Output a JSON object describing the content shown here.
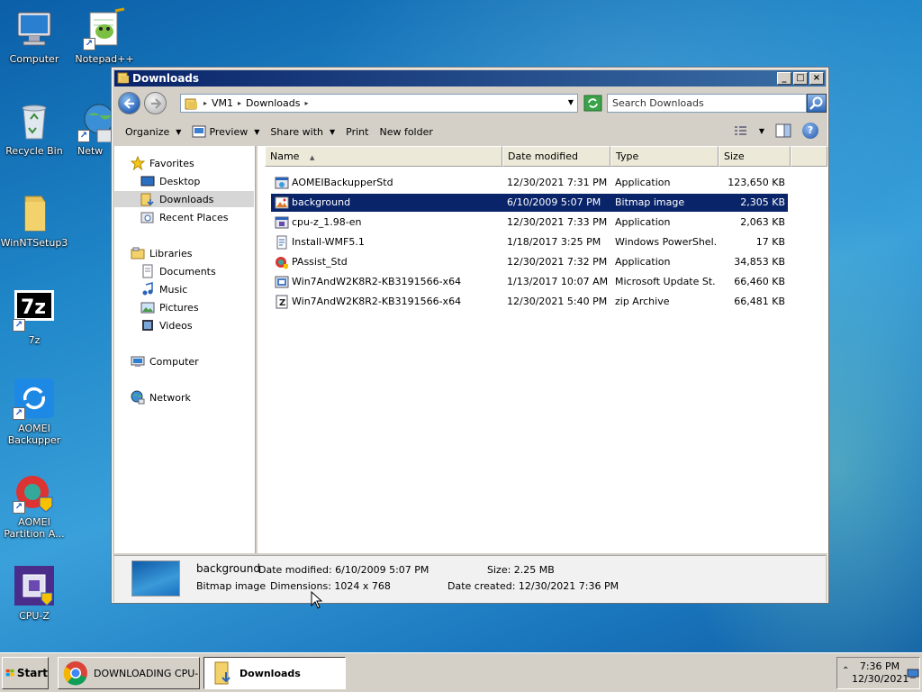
{
  "desktop": {
    "icons": [
      {
        "label": "Computer"
      },
      {
        "label": "Notepad++"
      },
      {
        "label": "Recycle Bin"
      },
      {
        "label": "Netw"
      },
      {
        "label": "WinNTSetup3"
      },
      {
        "label": "7z"
      },
      {
        "label": "AOMEI Backupper"
      },
      {
        "label": "AOMEI Partition A..."
      },
      {
        "label": "CPU-Z"
      }
    ]
  },
  "window": {
    "title": "Downloads",
    "buttons": {
      "minimize": "_",
      "maximize": "□",
      "close": "×"
    },
    "address": {
      "crumbs": [
        "VM1",
        "Downloads"
      ],
      "search_placeholder": "Search Downloads"
    },
    "toolbar": {
      "organize": "Organize",
      "preview": "Preview",
      "share_with": "Share with",
      "print": "Print",
      "new_folder": "New folder"
    },
    "nav": {
      "favorites": "Favorites",
      "desktop": "Desktop",
      "downloads": "Downloads",
      "recent_places": "Recent Places",
      "libraries": "Libraries",
      "documents": "Documents",
      "music": "Music",
      "pictures": "Pictures",
      "videos": "Videos",
      "computer": "Computer",
      "network": "Network"
    },
    "columns": {
      "name": "Name",
      "date": "Date modified",
      "type": "Type",
      "size": "Size"
    },
    "files": [
      {
        "name": "AOMEIBackupperStd",
        "date": "12/30/2021 7:31 PM",
        "type": "Application",
        "size": "123,650 KB",
        "icon": "app-icon"
      },
      {
        "name": "background",
        "date": "6/10/2009 5:07 PM",
        "type": "Bitmap image",
        "size": "2,305 KB",
        "icon": "bitmap-icon"
      },
      {
        "name": "cpu-z_1.98-en",
        "date": "12/30/2021 7:33 PM",
        "type": "Application",
        "size": "2,063 KB",
        "icon": "app-icon"
      },
      {
        "name": "Install-WMF5.1",
        "date": "1/18/2017 3:25 PM",
        "type": "Windows PowerShel...",
        "size": "17 KB",
        "icon": "script-icon"
      },
      {
        "name": "PAssist_Std",
        "date": "12/30/2021 7:32 PM",
        "type": "Application",
        "size": "34,853 KB",
        "icon": "app-icon"
      },
      {
        "name": "Win7AndW2K8R2-KB3191566-x64",
        "date": "1/13/2017 10:07 AM",
        "type": "Microsoft Update St...",
        "size": "66,460 KB",
        "icon": "update-icon"
      },
      {
        "name": "Win7AndW2K8R2-KB3191566-x64",
        "date": "12/30/2021 5:40 PM",
        "type": "zip Archive",
        "size": "66,481 KB",
        "icon": "zip-icon"
      }
    ],
    "details": {
      "name": "background",
      "type": "Bitmap image",
      "modified_label": "Date modified:",
      "modified_value": "6/10/2009 5:07 PM",
      "dimensions_label": "Dimensions:",
      "dimensions_value": "1024 x 768",
      "size_label": "Size:",
      "size_value": "2.25 MB",
      "created_label": "Date created:",
      "created_value": "12/30/2021 7:36 PM"
    }
  },
  "taskbar": {
    "start": "Start",
    "tasks": [
      {
        "label": "DOWNLOADING CPU-..."
      },
      {
        "label": "Downloads"
      }
    ],
    "clock": {
      "time": "7:36 PM",
      "date": "12/30/2021"
    }
  }
}
